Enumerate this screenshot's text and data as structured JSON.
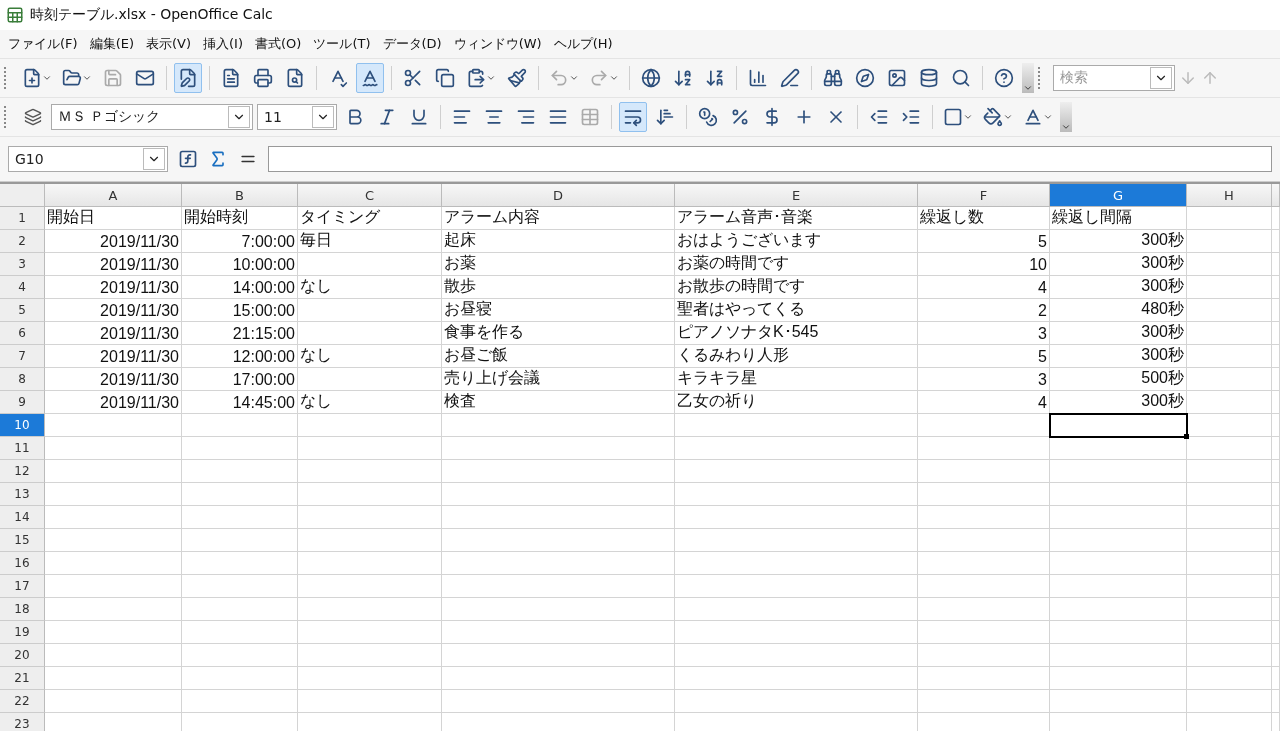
{
  "window": {
    "title": "時刻テーブル.xlsx - OpenOffice Calc"
  },
  "menu": [
    "ファイル(F)",
    "編集(E)",
    "表示(V)",
    "挿入(I)",
    "書式(O)",
    "ツール(T)",
    "データ(D)",
    "ウィンドウ(W)",
    "ヘルプ(H)"
  ],
  "toolbar_toggles": {
    "edit_file": true,
    "auto_spellcheck": true,
    "wrap_text": true
  },
  "search": {
    "placeholder": "検索"
  },
  "format_toolbar": {
    "font": "ＭＳ Ｐゴシック",
    "size": "11"
  },
  "name_box": "G10",
  "columns": [
    {
      "label": "A",
      "kind": "number",
      "selected": false
    },
    {
      "label": "B",
      "kind": "number",
      "selected": false
    },
    {
      "label": "C",
      "kind": "text",
      "selected": false
    },
    {
      "label": "D",
      "kind": "text",
      "selected": false
    },
    {
      "label": "E",
      "kind": "text",
      "selected": false
    },
    {
      "label": "F",
      "kind": "number",
      "selected": false
    },
    {
      "label": "G",
      "kind": "number",
      "selected": true
    },
    {
      "label": "H",
      "kind": "text",
      "selected": false
    }
  ],
  "rows": [
    {
      "number": "1",
      "kind": "header",
      "selected": false,
      "cells": [
        "開始日",
        "開始時刻",
        "タイミング",
        "アラーム内容",
        "アラーム音声･音楽",
        "繰返し数",
        "繰返し間隔"
      ]
    },
    {
      "number": "2",
      "kind": "data",
      "selected": false,
      "cells": [
        "2019/11/30",
        "7:00:00",
        "毎日",
        "起床",
        "おはようございます",
        "5",
        "300秒"
      ]
    },
    {
      "number": "3",
      "kind": "data",
      "selected": false,
      "cells": [
        "2019/11/30",
        "10:00:00",
        null,
        "お薬",
        "お薬の時間です",
        "10",
        "300秒"
      ]
    },
    {
      "number": "4",
      "kind": "data",
      "selected": false,
      "cells": [
        "2019/11/30",
        "14:00:00",
        "なし",
        "散歩",
        "お散歩の時間です",
        "4",
        "300秒"
      ]
    },
    {
      "number": "5",
      "kind": "data",
      "selected": false,
      "cells": [
        "2019/11/30",
        "15:00:00",
        null,
        "お昼寝",
        "聖者はやってくる",
        "2",
        "480秒"
      ]
    },
    {
      "number": "6",
      "kind": "data",
      "selected": false,
      "cells": [
        "2019/11/30",
        "21:15:00",
        null,
        "食事を作る",
        "ピアノソナタK･545",
        "3",
        "300秒"
      ]
    },
    {
      "number": "7",
      "kind": "data",
      "selected": false,
      "cells": [
        "2019/11/30",
        "12:00:00",
        "なし",
        "お昼ご飯",
        "くるみわり人形",
        "5",
        "300秒"
      ]
    },
    {
      "number": "8",
      "kind": "data",
      "selected": false,
      "cells": [
        "2019/11/30",
        "17:00:00",
        null,
        "売り上げ会議",
        "キラキラ星",
        "3",
        "500秒"
      ]
    },
    {
      "number": "9",
      "kind": "data",
      "selected": false,
      "cells": [
        "2019/11/30",
        "14:45:00",
        "なし",
        "検査",
        "乙女の祈り",
        "4",
        "300秒"
      ]
    },
    {
      "number": "10",
      "kind": "data",
      "selected": true
    },
    {
      "number": "11",
      "kind": "data",
      "selected": false
    },
    {
      "number": "12",
      "kind": "data",
      "selected": false
    },
    {
      "number": "13",
      "kind": "data",
      "selected": false
    },
    {
      "number": "14",
      "kind": "data",
      "selected": false
    },
    {
      "number": "15",
      "kind": "data",
      "selected": false
    },
    {
      "number": "16",
      "kind": "data",
      "selected": false
    },
    {
      "number": "17",
      "kind": "data",
      "selected": false
    },
    {
      "number": "18",
      "kind": "data",
      "selected": false
    },
    {
      "number": "19",
      "kind": "data",
      "selected": false
    },
    {
      "number": "20",
      "kind": "data",
      "selected": false
    },
    {
      "number": "21",
      "kind": "data",
      "selected": false
    },
    {
      "number": "22",
      "kind": "data",
      "selected": false
    },
    {
      "number": "23",
      "kind": "data",
      "selected": false
    }
  ]
}
